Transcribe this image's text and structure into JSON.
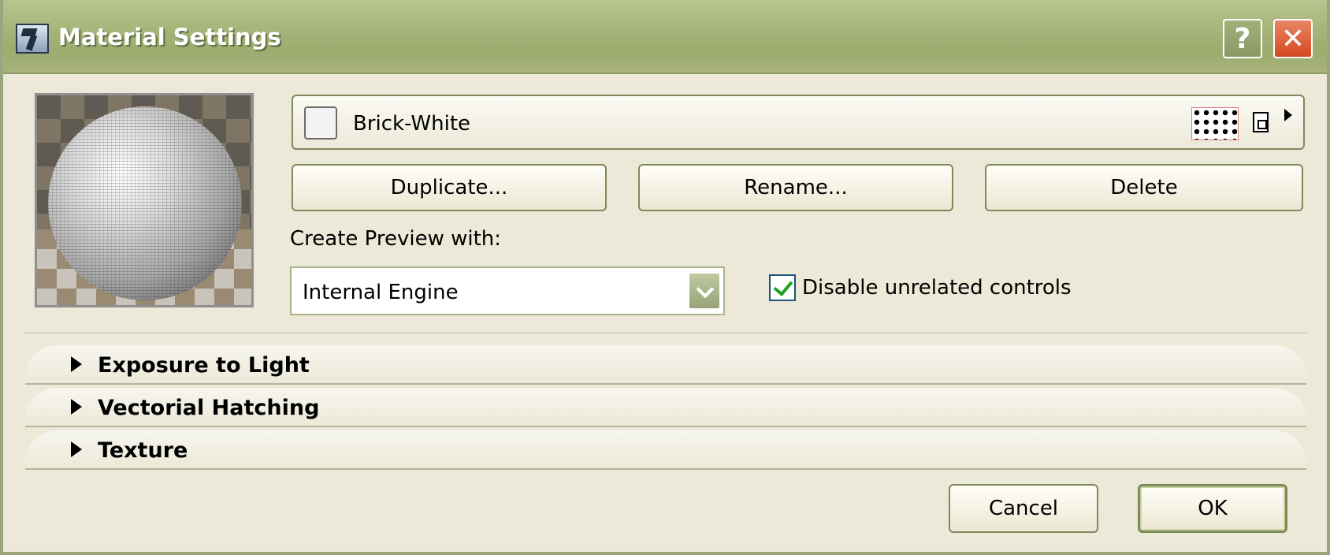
{
  "window": {
    "title": "Material Settings"
  },
  "titlebar": {
    "help_label": "?",
    "close_label": "✕"
  },
  "material": {
    "name": "Brick-White"
  },
  "actions": {
    "duplicate_label": "Duplicate...",
    "rename_label": "Rename...",
    "delete_label": "Delete"
  },
  "preview": {
    "label": "Create Preview with:",
    "engine": "Internal Engine"
  },
  "options": {
    "disable_unrelated_label": "Disable unrelated controls",
    "disable_unrelated_checked": true
  },
  "sections": [
    {
      "label": "Exposure to Light"
    },
    {
      "label": "Vectorial Hatching"
    },
    {
      "label": "Texture"
    }
  ],
  "footer": {
    "cancel_label": "Cancel",
    "ok_label": "OK"
  }
}
